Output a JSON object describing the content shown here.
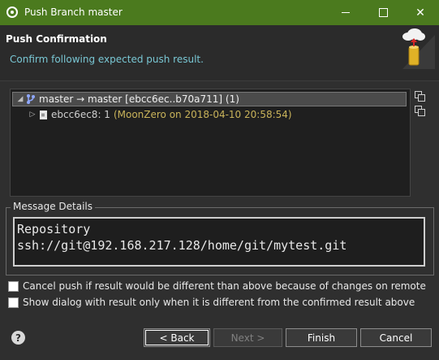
{
  "window": {
    "title": "Push Branch master"
  },
  "header": {
    "title": "Push Confirmation",
    "description": "Confirm following expected push result."
  },
  "tree": {
    "root_label": "master → master [ebcc6ec..b70a711] (1)",
    "commit_id": "ebcc6ec8: 1",
    "commit_author": "(MoonZero on 2018-04-10 20:58:54)"
  },
  "message_details": {
    "legend": "Message Details",
    "lines": [
      "Repository",
      "ssh://git@192.168.217.128/home/git/mytest.git"
    ]
  },
  "options": {
    "cancel_if_different": "Cancel push if result would be different than above because of changes on remote",
    "show_only_if_different": "Show dialog with result only when it is different from the confirmed result above"
  },
  "buttons": {
    "back": "< Back",
    "next": "Next >",
    "finish": "Finish",
    "cancel": "Cancel"
  },
  "colors": {
    "titlebar": "#4b7a1e",
    "accent_text": "#79c7d4",
    "author_text": "#c9b35a"
  }
}
